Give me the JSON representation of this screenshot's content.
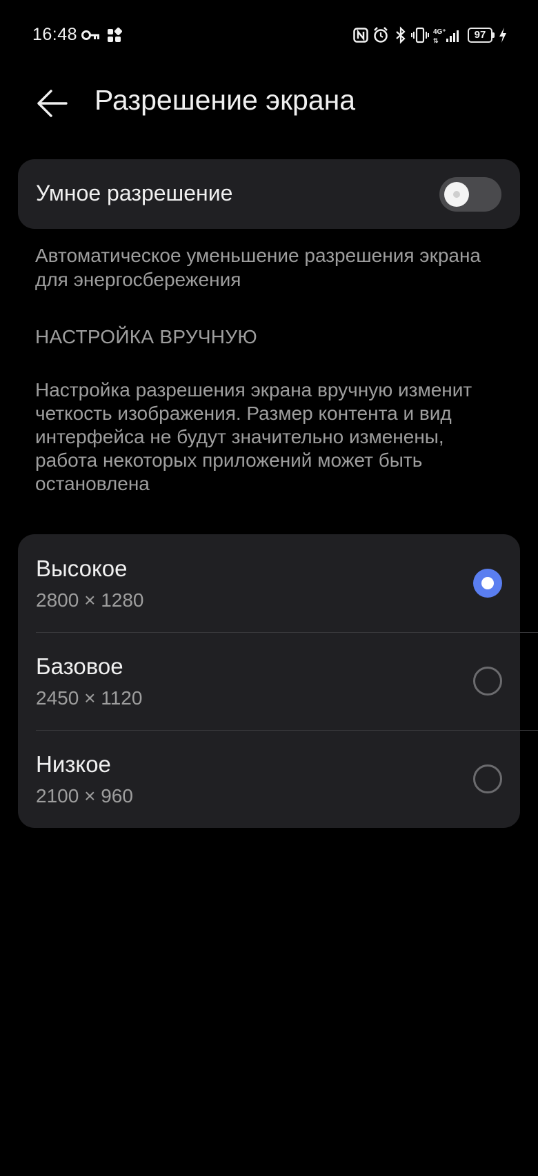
{
  "status_bar": {
    "time": "16:48",
    "battery_level": "97",
    "icons": [
      "key-icon",
      "apps-icon",
      "nfc-icon",
      "alarm-icon",
      "bluetooth-icon",
      "vibrate-icon",
      "network-4g-icon",
      "signal-icon",
      "charging-icon"
    ]
  },
  "header": {
    "title": "Разрешение экрана",
    "back_icon": "arrow-left-icon"
  },
  "smart_resolution": {
    "label": "Умное разрешение",
    "enabled": false,
    "description": "Автоматическое уменьшение разрешения экрана для энергосбережения"
  },
  "manual": {
    "section_title": "НАСТРОЙКА ВРУЧНУЮ",
    "description": "Настройка разрешения экрана вручную изменит четкость изображения. Размер контента и вид интерфейса не будут значительно изменены, работа некоторых приложений может быть остановлена"
  },
  "resolutions": [
    {
      "title": "Высокое",
      "value": "2800 × 1280",
      "selected": true
    },
    {
      "title": "Базовое",
      "value": "2450 × 1120",
      "selected": false
    },
    {
      "title": "Низкое",
      "value": "2100 × 960",
      "selected": false
    }
  ],
  "colors": {
    "background": "#000000",
    "card": "#202023",
    "accent": "#5a7ef0",
    "secondary_text": "#9e9e9e"
  }
}
